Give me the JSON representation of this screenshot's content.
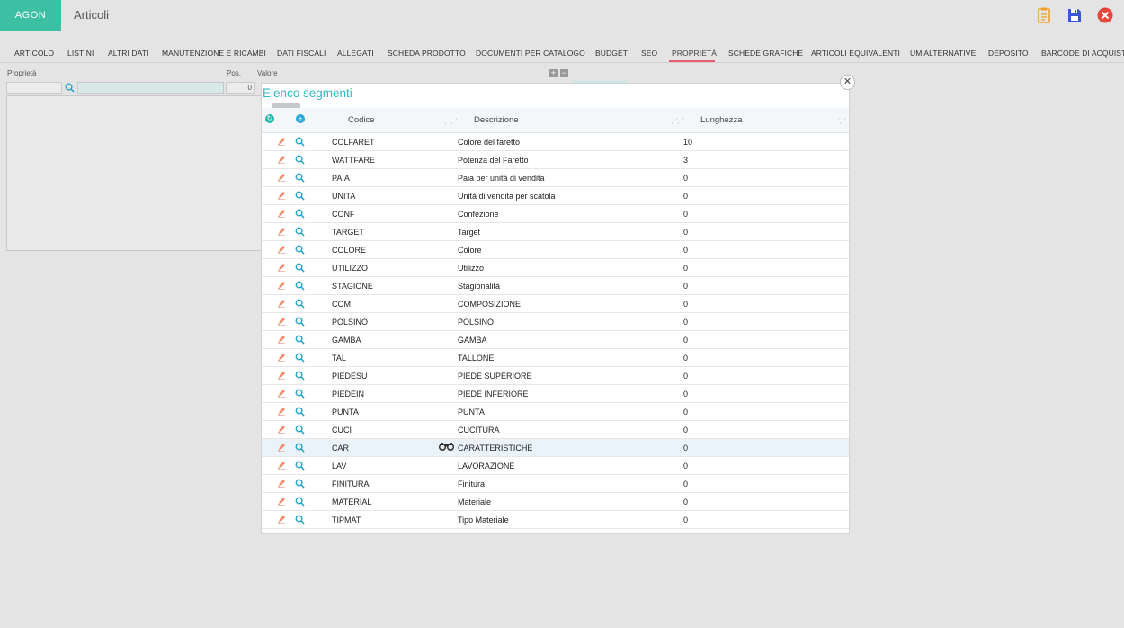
{
  "header": {
    "logo": "AGON",
    "title": "Articoli"
  },
  "tabs": [
    {
      "label": "ARTICOLO",
      "active": false
    },
    {
      "label": "LISTINI",
      "active": false
    },
    {
      "label": "ALTRI DATI",
      "active": false
    },
    {
      "label": "MANUTENZIONE E RICAMBI",
      "active": false
    },
    {
      "label": "DATI FISCALI",
      "active": false
    },
    {
      "label": "ALLEGATI",
      "active": false
    },
    {
      "label": "SCHEDA PRODOTTO",
      "active": false
    },
    {
      "label": "DOCUMENTI PER CATALOGO",
      "active": false
    },
    {
      "label": "BUDGET",
      "active": false
    },
    {
      "label": "SEO",
      "active": false
    },
    {
      "label": "PROPRIETÀ",
      "active": true
    },
    {
      "label": "SCHEDE GRAFICHE",
      "active": false
    },
    {
      "label": "ARTICOLI EQUIVALENTI",
      "active": false
    },
    {
      "label": "UM ALTERNATIVE",
      "active": false
    },
    {
      "label": "DEPOSITO",
      "active": false
    },
    {
      "label": "BARCODE DI ACQUISTO",
      "active": false
    }
  ],
  "properties": {
    "col_proprieta": "Proprietà",
    "col_pos": "Pos.",
    "col_valore": "Valore",
    "pos_value": "0"
  },
  "modal": {
    "title": "Elenco segmenti",
    "columns": {
      "codice": "Codice",
      "descrizione": "Descrizione",
      "lunghezza": "Lunghezza"
    },
    "rows": [
      {
        "codice": "COLFARET",
        "descrizione": "Colore del faretto",
        "lunghezza": "10"
      },
      {
        "codice": "WATTFARE",
        "descrizione": "Potenza del Faretto",
        "lunghezza": "3"
      },
      {
        "codice": "PAIA",
        "descrizione": "Paia per unità di vendita",
        "lunghezza": "0"
      },
      {
        "codice": "UNITA",
        "descrizione": "Unità di vendita per scatola",
        "lunghezza": "0"
      },
      {
        "codice": "CONF",
        "descrizione": "Confezione",
        "lunghezza": "0"
      },
      {
        "codice": "TARGET",
        "descrizione": "Target",
        "lunghezza": "0"
      },
      {
        "codice": "COLORE",
        "descrizione": "Colore",
        "lunghezza": "0"
      },
      {
        "codice": "UTILIZZO",
        "descrizione": "Utilizzo",
        "lunghezza": "0"
      },
      {
        "codice": "STAGIONE",
        "descrizione": "Stagionalità",
        "lunghezza": "0"
      },
      {
        "codice": "COM",
        "descrizione": "COMPOSIZIONE",
        "lunghezza": "0"
      },
      {
        "codice": "POLSINO",
        "descrizione": "POLSINO",
        "lunghezza": "0"
      },
      {
        "codice": "GAMBA",
        "descrizione": "GAMBA",
        "lunghezza": "0"
      },
      {
        "codice": "TAL",
        "descrizione": "TALLONE",
        "lunghezza": "0"
      },
      {
        "codice": "PIEDESU",
        "descrizione": "PIEDE SUPERIORE",
        "lunghezza": "0"
      },
      {
        "codice": "PIEDEIN",
        "descrizione": "PIEDE INFERIORE",
        "lunghezza": "0"
      },
      {
        "codice": "PUNTA",
        "descrizione": "PUNTA",
        "lunghezza": "0"
      },
      {
        "codice": "CUCI",
        "descrizione": "CUCITURA",
        "lunghezza": "0"
      },
      {
        "codice": "CAR",
        "descrizione": "CARATTERISTICHE",
        "lunghezza": "0",
        "highlight": true
      },
      {
        "codice": "LAV",
        "descrizione": "LAVORAZIONE",
        "lunghezza": "0"
      },
      {
        "codice": "FINITURA",
        "descrizione": "Finitura",
        "lunghezza": "0"
      },
      {
        "codice": "MATERIAL",
        "descrizione": "Materiale",
        "lunghezza": "0"
      },
      {
        "codice": "TIPMAT",
        "descrizione": "Tipo Materiale",
        "lunghezza": "0"
      }
    ]
  },
  "colors": {
    "accent": "#3dbfa4",
    "title": "#35b8c8",
    "active_tab_underline": "#e65a74"
  }
}
